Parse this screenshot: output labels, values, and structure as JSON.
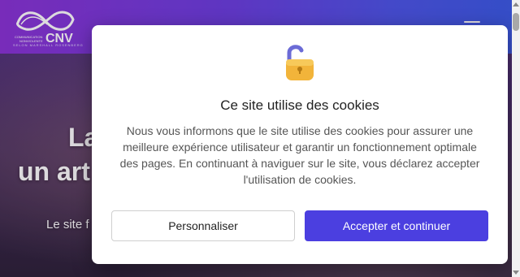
{
  "brand": {
    "logo_text": "CNV",
    "logo_tagline": "COMMUNICATION NONVIOLENTE",
    "logo_sub": "SELON MARSHALL ROSENBERG"
  },
  "hero": {
    "title_line1": "La",
    "title_line2": "un art",
    "subtitle": "Le site f"
  },
  "cookie_modal": {
    "title": "Ce site utilise des cookies",
    "body": "Nous vous informons que le site utilise des cookies pour assurer une meilleure expérience utilisateur et garantir un fonctionnement optimale des pages. En continuant à naviguer sur le site, vous déclarez accepter l'utilisation de cookies.",
    "customize_label": "Personnaliser",
    "accept_label": "Accepter et continuer"
  },
  "colors": {
    "accent": "#4b3fe0",
    "header_gradient_start": "#8a33d6",
    "header_gradient_end": "#3a5be6"
  },
  "icons": {
    "lock": "lock-open-icon",
    "menu": "hamburger-menu-icon"
  }
}
